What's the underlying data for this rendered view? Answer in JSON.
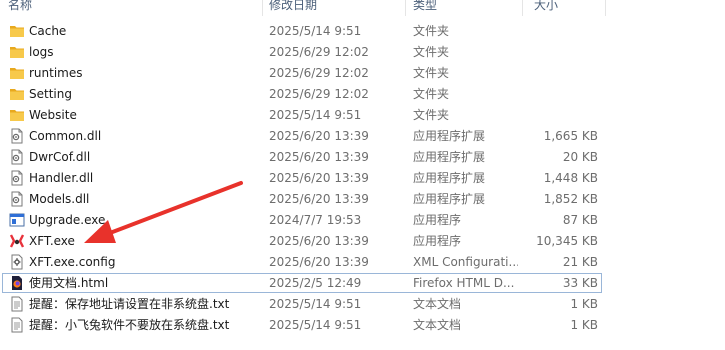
{
  "header": {
    "name": "名称",
    "date": "修改日期",
    "type": "类型",
    "size": "大小"
  },
  "rows": [
    {
      "icon": "folder-icon",
      "name": "Cache",
      "date": "2025/5/14 9:51",
      "type": "文件夹",
      "size": ""
    },
    {
      "icon": "folder-icon",
      "name": "logs",
      "date": "2025/6/29 12:02",
      "type": "文件夹",
      "size": ""
    },
    {
      "icon": "folder-icon",
      "name": "runtimes",
      "date": "2025/6/29 12:02",
      "type": "文件夹",
      "size": ""
    },
    {
      "icon": "folder-icon",
      "name": "Setting",
      "date": "2025/6/29 12:02",
      "type": "文件夹",
      "size": ""
    },
    {
      "icon": "folder-icon",
      "name": "Website",
      "date": "2025/5/14 9:51",
      "type": "文件夹",
      "size": ""
    },
    {
      "icon": "dll-file-icon",
      "name": "Common.dll",
      "date": "2025/6/20 13:39",
      "type": "应用程序扩展",
      "size": "1,665 KB"
    },
    {
      "icon": "dll-file-icon",
      "name": "DwrCof.dll",
      "date": "2025/6/20 13:39",
      "type": "应用程序扩展",
      "size": "20 KB"
    },
    {
      "icon": "dll-file-icon",
      "name": "Handler.dll",
      "date": "2025/6/20 13:39",
      "type": "应用程序扩展",
      "size": "1,448 KB"
    },
    {
      "icon": "dll-file-icon",
      "name": "Models.dll",
      "date": "2025/6/20 13:39",
      "type": "应用程序扩展",
      "size": "1,852 KB"
    },
    {
      "icon": "exe-window-icon",
      "name": "Upgrade.exe",
      "date": "2024/7/7 19:53",
      "type": "应用程序",
      "size": "87 KB"
    },
    {
      "icon": "xft-app-icon",
      "name": "XFT.exe",
      "date": "2025/6/20 13:39",
      "type": "应用程序",
      "size": "10,345 KB"
    },
    {
      "icon": "config-file-icon",
      "name": "XFT.exe.config",
      "date": "2025/6/20 13:39",
      "type": "XML Configurati...",
      "size": "21 KB"
    },
    {
      "icon": "firefox-html-icon",
      "name": "使用文档.html",
      "date": "2025/2/5 12:49",
      "type": "Firefox HTML D...",
      "size": "33 KB",
      "selected": true
    },
    {
      "icon": "text-file-icon",
      "name": "提醒：保存地址请设置在非系统盘.txt",
      "date": "2025/5/14 9:51",
      "type": "文本文档",
      "size": "1 KB"
    },
    {
      "icon": "text-file-icon",
      "name": "提醒：小飞兔软件不要放在系统盘.txt",
      "date": "2025/5/14 9:51",
      "type": "文本文档",
      "size": "1 KB"
    }
  ],
  "colors": {
    "folder": "#f4c144",
    "arrow": "#e8322b",
    "selection_border": "#9ab6d8"
  }
}
